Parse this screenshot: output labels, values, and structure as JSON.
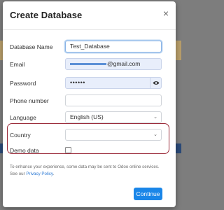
{
  "dialog": {
    "title": "Create Database",
    "close_glyph": "×"
  },
  "fields": {
    "database_name": {
      "label": "Database Name",
      "value": "Test_Database"
    },
    "email": {
      "label": "Email",
      "value_suffix": "@gmail.com"
    },
    "password": {
      "label": "Password",
      "value_masked": "••••••"
    },
    "phone": {
      "label": "Phone number",
      "value": ""
    },
    "language": {
      "label": "Language",
      "value": "English (US)"
    },
    "country": {
      "label": "Country",
      "value": ""
    },
    "demo_data": {
      "label": "Demo data",
      "checked": false
    }
  },
  "icons": {
    "password_toggle": "eye-icon",
    "language_dropdown": "chevron-down-icon",
    "country_dropdown": "chevron-down-icon"
  },
  "note": {
    "text": "To enhance your experience, some data may be sent to Odoo online services. See our",
    "link": "Privacy Policy",
    "end": "."
  },
  "footer": {
    "continue_label": "Continue"
  },
  "colors": {
    "primary": "#1a86e8",
    "highlight_border": "#9b2b3a",
    "autofill_bg": "#e8eefb"
  }
}
